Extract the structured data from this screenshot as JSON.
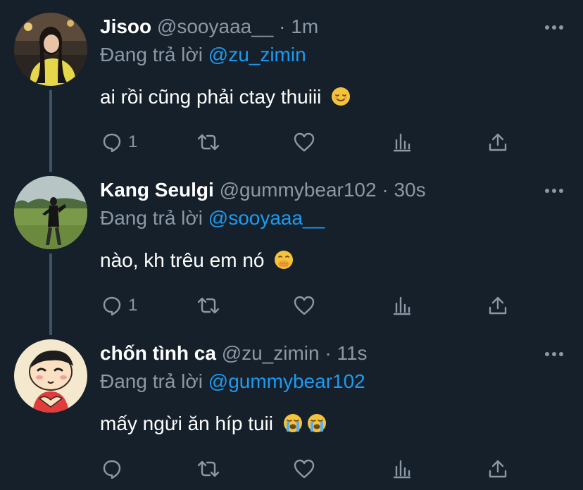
{
  "reply_prefix": "Đang trả lời",
  "colors": {
    "background": "#15202b",
    "secondary_text": "#8b98a5",
    "link": "#1d9bf0",
    "thread_line": "#3d5466"
  },
  "tweets": [
    {
      "name": "Jisoo",
      "handle": "@sooyaaa__",
      "dot": "·",
      "time": "1m",
      "replying_to": "@zu_zimin",
      "text": "ai rồi cũng phải ctay thuiii",
      "emoji": [
        "relieved-face"
      ],
      "reply_count": "1"
    },
    {
      "name": "Kang Seulgi",
      "handle": "@gummybear102",
      "dot": "·",
      "time": "30s",
      "replying_to": "@sooyaaa__",
      "text": "nào, kh trêu em nó",
      "emoji": [
        "face-with-hand-over-mouth"
      ],
      "reply_count": "1"
    },
    {
      "name": "chốn tình ca",
      "handle": "@zu_zimin",
      "dot": "·",
      "time": "11s",
      "replying_to": "@gummybear102",
      "text": "mấy ngừi ăn híp tuii",
      "emoji": [
        "loudly-crying-face",
        "loudly-crying-face"
      ],
      "reply_count": ""
    }
  ]
}
